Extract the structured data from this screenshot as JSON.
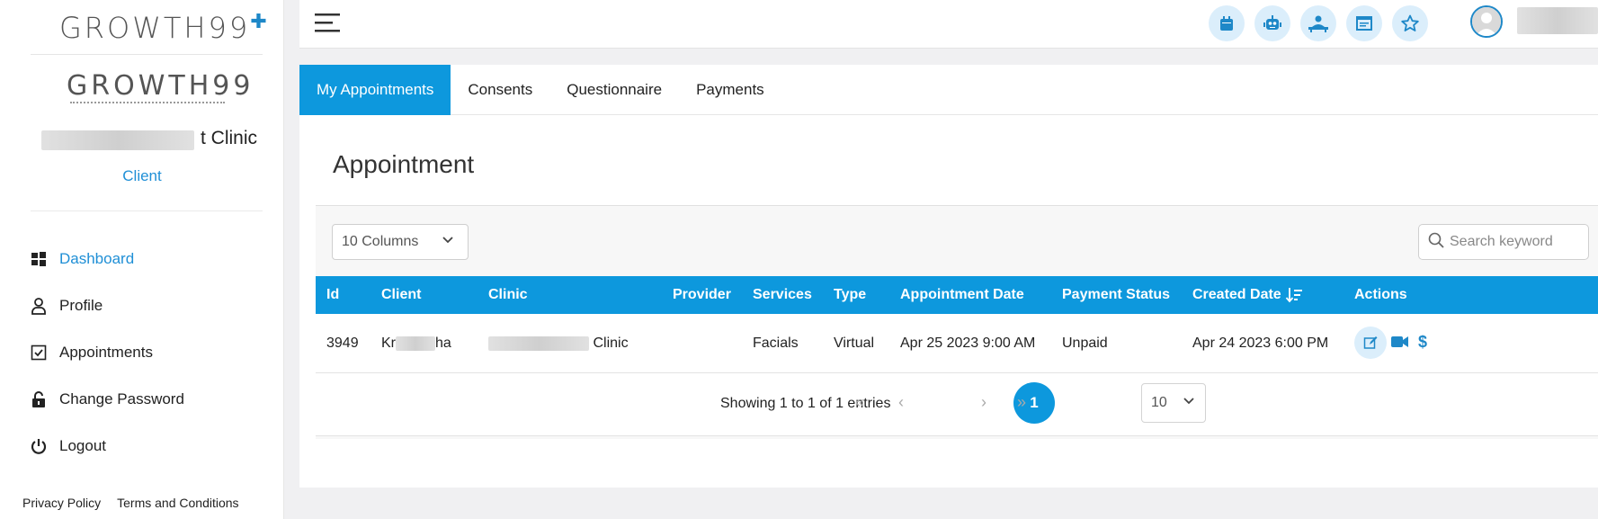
{
  "brand": {
    "logo_top": "GROWTH99",
    "logo_top_badge": "PLUS",
    "logo_secondary": "GROWTH99"
  },
  "profile": {
    "clinic_suffix": "t Clinic",
    "role": "Client"
  },
  "sidebar": {
    "items": [
      {
        "label": "Dashboard",
        "icon": "windows-icon",
        "active": true
      },
      {
        "label": "Profile",
        "icon": "user-icon"
      },
      {
        "label": "Appointments",
        "icon": "checkbox-icon"
      },
      {
        "label": "Change Password",
        "icon": "lock-icon"
      },
      {
        "label": "Logout",
        "icon": "power-icon"
      }
    ],
    "footer": {
      "privacy": "Privacy Policy",
      "terms": "Terms and Conditions"
    }
  },
  "topbar": {
    "icons": [
      "calendar-icon",
      "robot-icon",
      "doctor-icon",
      "browser-icon",
      "star-icon"
    ]
  },
  "tabs": [
    {
      "label": "My Appointments",
      "active": true
    },
    {
      "label": "Consents"
    },
    {
      "label": "Questionnaire"
    },
    {
      "label": "Payments"
    }
  ],
  "page": {
    "title": "Appointment"
  },
  "table_controls": {
    "columns_label": "10 Columns",
    "search_placeholder": "Search keyword"
  },
  "table": {
    "headers": [
      "Id",
      "Client",
      "Clinic",
      "Provider",
      "Services",
      "Type",
      "Appointment Date",
      "Payment Status",
      "Created Date",
      "Actions"
    ],
    "rows": [
      {
        "id": "3949",
        "client_prefix": "Kr",
        "client_suffix": "ha",
        "clinic_suffix": "Clinic",
        "provider": "",
        "services": "Facials",
        "type": "Virtual",
        "appointment_date": "Apr 25 2023 9:00 AM",
        "payment_status": "Unpaid",
        "created_date": "Apr 24 2023 6:00 PM",
        "price_symbol": "$"
      }
    ]
  },
  "pagination": {
    "showing": "Showing 1 to 1 of 1 entries",
    "first": "«",
    "prev": "‹",
    "current": "1",
    "next": "›",
    "last": "»",
    "page_size": "10"
  },
  "colors": {
    "accent": "#0d98dd",
    "link": "#1f8fd6"
  }
}
